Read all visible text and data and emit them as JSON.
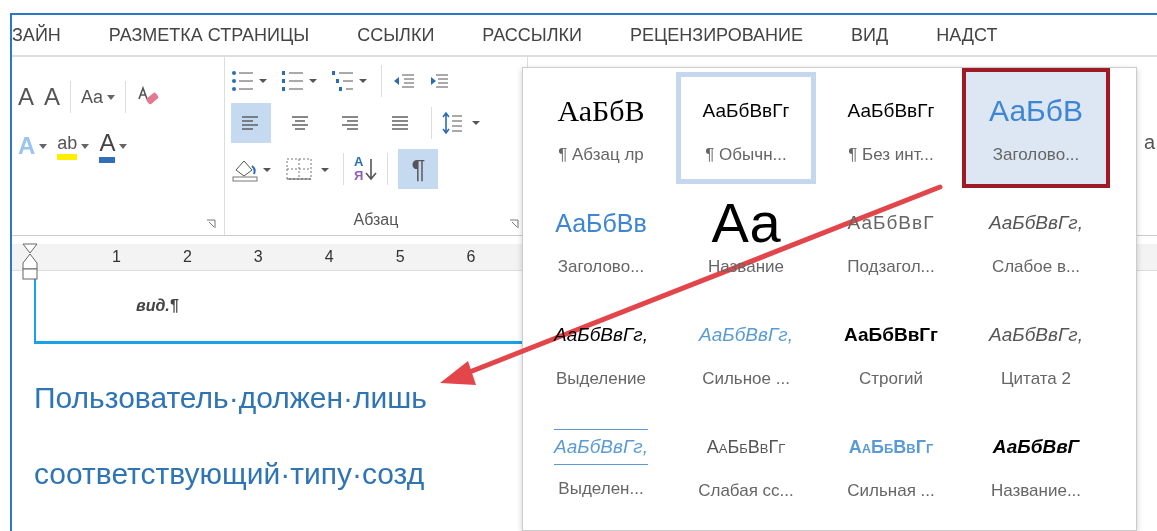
{
  "tabs": [
    {
      "label": "ЗАЙН"
    },
    {
      "label": "РАЗМЕТКА СТРАНИЦЫ"
    },
    {
      "label": "ССЫЛКИ"
    },
    {
      "label": "РАССЫЛКИ"
    },
    {
      "label": "РЕЦЕНЗИРОВАНИЕ"
    },
    {
      "label": "ВИД"
    },
    {
      "label": "НАДСТ"
    }
  ],
  "font_group": {
    "grow": "A",
    "shrink": "A",
    "change_case": "Aa",
    "effects": "A",
    "highlight": "ab",
    "font_color": "A"
  },
  "paragraph_group": {
    "label": "Абзац",
    "alignment": [
      {
        "kind": "left",
        "selected": true
      },
      {
        "kind": "center",
        "selected": false
      },
      {
        "kind": "right",
        "selected": false
      },
      {
        "kind": "justify",
        "selected": false
      }
    ],
    "sort": {
      "top": "А",
      "bottom": "Я"
    },
    "show_marks": {
      "glyph": "¶",
      "on": true
    }
  },
  "ribbon_overflow_text": "а",
  "ruler": {
    "numbers": [
      "1",
      "2",
      "3",
      "4",
      "5",
      "6"
    ]
  },
  "document": {
    "cut_line": "вид.¶",
    "lines": [
      "Пользователь·должен·лишь",
      "соответствующий·типу·созд"
    ]
  },
  "styles_gallery": [
    {
      "sample": "АаБбВ",
      "name": "¶ Абзац лр",
      "kind": "serif",
      "selected": false,
      "highlighted": false
    },
    {
      "sample": "АаБбВвГг",
      "name": "¶ Обычн...",
      "kind": "normal",
      "selected": true,
      "highlighted": false
    },
    {
      "sample": "АаБбВвГг",
      "name": "¶ Без инт...",
      "kind": "normal",
      "selected": false,
      "highlighted": false
    },
    {
      "sample": "АаБбВ",
      "name": "Заголово...",
      "kind": "heading1",
      "selected": false,
      "highlighted": true
    },
    {
      "sample": "АаБбВв",
      "name": "Заголово...",
      "kind": "heading2",
      "selected": false,
      "highlighted": false
    },
    {
      "sample": "Аа",
      "name": "Название",
      "kind": "title",
      "selected": false,
      "highlighted": false
    },
    {
      "sample": "АаБбВвГ",
      "name": "Подзагол...",
      "kind": "subtitle",
      "selected": false,
      "highlighted": false
    },
    {
      "sample": "АаБбВвГг,",
      "name": "Слабое в...",
      "kind": "subtle-emphasis",
      "selected": false,
      "highlighted": false
    },
    {
      "sample": "АаБбВвГг,",
      "name": "Выделение",
      "kind": "emphasis",
      "selected": false,
      "highlighted": false
    },
    {
      "sample": "АаБбВвГг,",
      "name": "Сильное ...",
      "kind": "intense-emphasis",
      "selected": false,
      "highlighted": false
    },
    {
      "sample": "АаБбВвГг",
      "name": "Строгий",
      "kind": "strong",
      "selected": false,
      "highlighted": false
    },
    {
      "sample": "АаБбВвГг,",
      "name": "Цитата 2",
      "kind": "quote",
      "selected": false,
      "highlighted": false
    },
    {
      "sample": "АаБбВвГг,",
      "name": "Выделен...",
      "kind": "intense-quote",
      "selected": false,
      "highlighted": false
    },
    {
      "sample": "АаБбВвГг",
      "name": "Слабая сс...",
      "kind": "subtle-reference",
      "selected": false,
      "highlighted": false
    },
    {
      "sample": "АаБбВвГг",
      "name": "Сильная ...",
      "kind": "intense-reference",
      "selected": false,
      "highlighted": false
    },
    {
      "sample": "АаБбВвГ",
      "name": "Название...",
      "kind": "book-title",
      "selected": false,
      "highlighted": false
    }
  ]
}
